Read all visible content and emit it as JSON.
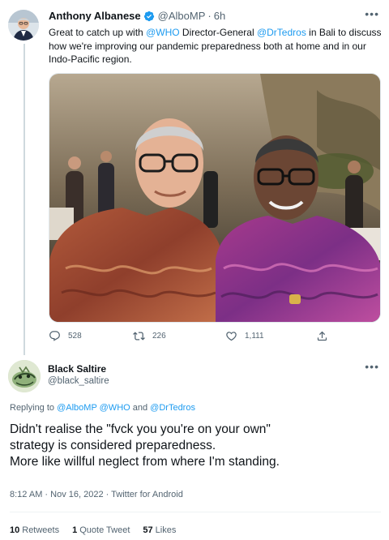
{
  "parent_tweet": {
    "author_name": "Anthony Albanese",
    "handle": "@AlboMP",
    "separator": "·",
    "time": "6h",
    "more_label": "•••",
    "text_parts": {
      "t1": "Great to catch up with ",
      "m1": "@WHO",
      "t2": " Director-General ",
      "m2": "@DrTedros",
      "t3": " in Bali to discuss how we're improving our pandemic preparedness both at home and in our Indo-Pacific region."
    },
    "replies": "528",
    "retweets": "226",
    "likes": "1,111"
  },
  "main_tweet": {
    "author_name": "Black Saltire",
    "handle": "@black_saltire",
    "more_label": "•••",
    "replying_prefix": "Replying to ",
    "replying_to_1": "@AlboMP",
    "replying_to_2": "@WHO",
    "replying_and": " and ",
    "replying_to_3": "@DrTedros",
    "text_lines": [
      "Didn't realise the \"fvck you you're on your own\"",
      "strategy is considered preparedness.",
      "More like willful neglect from where I'm standing."
    ],
    "time": "8:12 AM",
    "date": "Nov 16, 2022",
    "meta_sep": " · ",
    "source": "Twitter for Android",
    "stats": {
      "retweets_count": "10",
      "retweets_label": "Retweets",
      "quotes_count": "1",
      "quotes_label": "Quote Tweet",
      "likes_count": "57",
      "likes_label": "Likes"
    }
  },
  "colors": {
    "link": "#1d9bf0",
    "secondary_text": "#536471",
    "primary_text": "#0f1419"
  }
}
